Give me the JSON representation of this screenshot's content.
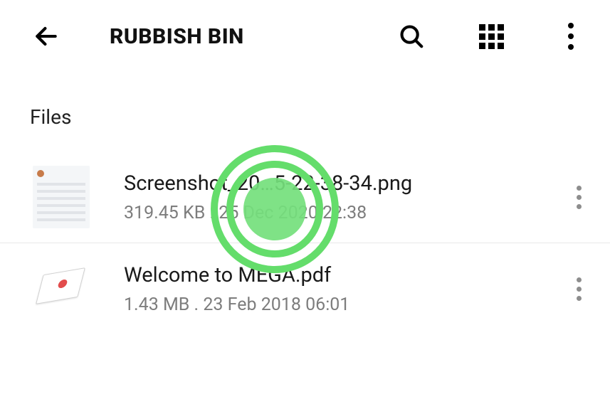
{
  "header": {
    "title": "RUBBISH BIN"
  },
  "section": {
    "label": "Files"
  },
  "files": [
    {
      "name": "Screenshot_20…5-22-38-34.png",
      "meta": "319.45 KB . 25 Dec 2020 22:38",
      "thumb": "screenshot"
    },
    {
      "name": "Welcome to MEGA.pdf",
      "meta": "1.43 MB . 23 Feb 2018 06:01",
      "thumb": "pdf"
    }
  ]
}
